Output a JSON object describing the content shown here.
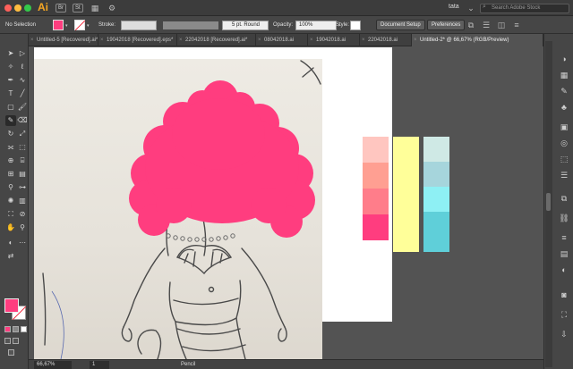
{
  "app": {
    "logo": "Ai",
    "bridge_label": "Br",
    "stock_label": "St",
    "user": "tata",
    "search_placeholder": "Search Adobe Stock"
  },
  "control_bar": {
    "selection_label": "No Selection",
    "stroke_label": "Stroke:",
    "brush_label": "5 pt. Round",
    "opacity_label": "Opacity:",
    "opacity_value": "100%",
    "style_label": "Style:",
    "document_setup": "Document Setup",
    "preferences": "Preferences"
  },
  "tabs": [
    {
      "label": "Untitled-5 [Recovered].ai*",
      "active": false
    },
    {
      "label": "19042018 [Recovered].eps*",
      "active": false
    },
    {
      "label": "22042018 [Recovered].ai*",
      "active": false
    },
    {
      "label": "08042018.ai",
      "active": false
    },
    {
      "label": "19042018.ai",
      "active": false
    },
    {
      "label": "22042018.ai",
      "active": false
    },
    {
      "label": "Untitled-2* @ 66,67% (RGB/Preview)",
      "active": true
    }
  ],
  "status_bar": {
    "zoom": "66,67%",
    "page": "1",
    "tool_name": "Pencil"
  },
  "colors": {
    "fill": "#ff3d7f",
    "stroke": "#ffffff",
    "palette_pink": [
      "#ffc6c0",
      "#ff9f92",
      "#ff7d8a",
      "#ff3d7f"
    ],
    "palette_yellow": [
      "#ffff99"
    ],
    "palette_blue": [
      "#cfe9e5",
      "#a6d5dc",
      "#8ef0f4",
      "#5fcfd9"
    ]
  },
  "tool_icons": [
    "selection-tool-icon",
    "direct-selection-tool-icon",
    "magic-wand-icon",
    "lasso-icon",
    "pen-tool-icon",
    "curvature-icon",
    "type-tool-icon",
    "line-tool-icon",
    "rectangle-tool-icon",
    "paintbrush-icon",
    "pencil-icon",
    "eraser-icon",
    "rotate-icon",
    "scale-icon",
    "width-tool-icon",
    "warp-icon",
    "free-transform-icon",
    "shape-builder-icon",
    "perspective-icon",
    "mesh-icon",
    "gradient-icon",
    "eyedropper-icon",
    "blend-icon",
    "symbol-sprayer-icon",
    "graph-icon",
    "artboard-tool-icon",
    "slice-icon",
    "hand-icon",
    "zoom-icon"
  ]
}
